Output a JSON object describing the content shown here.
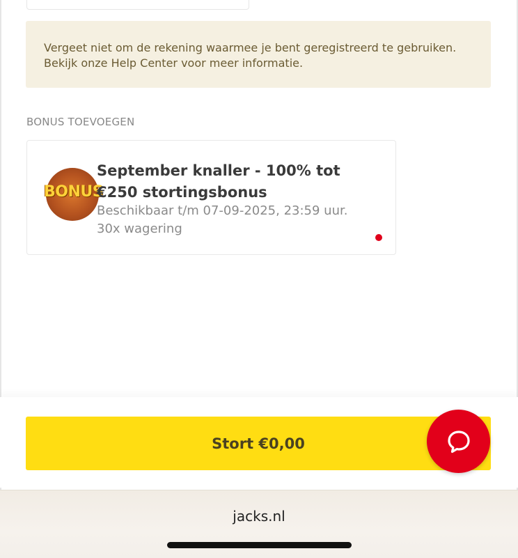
{
  "info": {
    "line1": "Vergeet niet om de rekening waarmee je bent geregistreerd te gebruiken.",
    "line2": "Bekijk onze Help Center voor meer informatie."
  },
  "bonus_section": {
    "label": "BONUS TOEVOEGEN",
    "card": {
      "badge_text": "BONUS",
      "title": "September knaller - 100% tot €250 stortingsbonus",
      "available": "Beschikbaar t/m 07-09-2025, 23:59 uur.",
      "wagering": "30x wagering"
    }
  },
  "deposit_button": {
    "label": "Stort €0,00"
  },
  "chat_button": {
    "icon": "chat-bubble-icon"
  },
  "browser": {
    "url": "jacks.nl"
  },
  "colors": {
    "accent_yellow": "#ffdd12",
    "brand_red": "#e2001a",
    "info_bg": "#f5f0e1",
    "info_text": "#6a5b33"
  }
}
